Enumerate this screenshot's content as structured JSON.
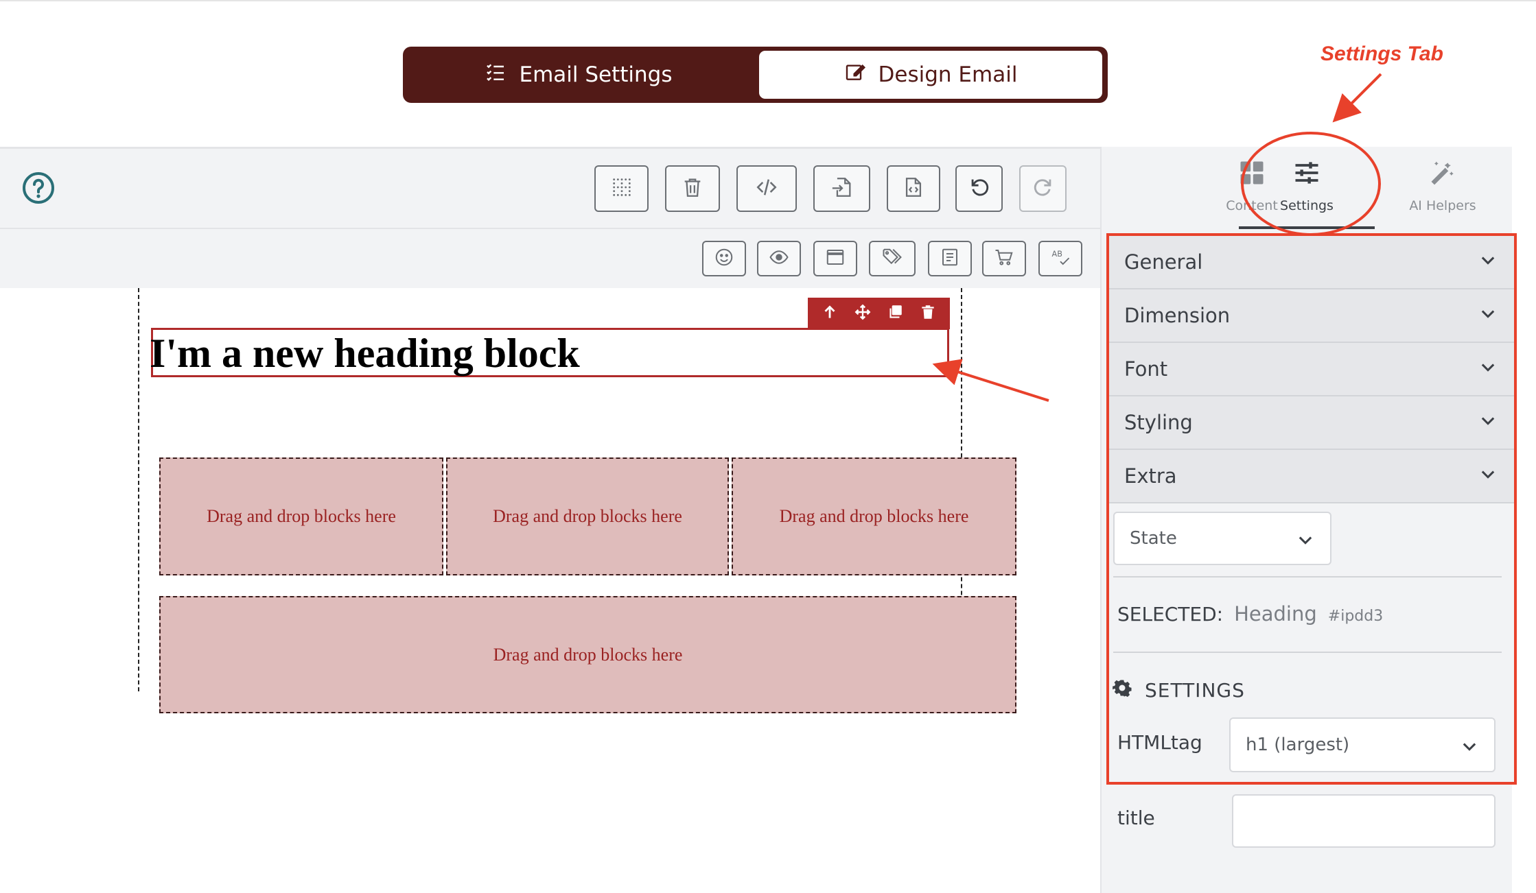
{
  "mode_toggle": {
    "email_settings_label": "Email Settings",
    "design_email_label": "Design Email"
  },
  "toolbar": {
    "top_buttons": [
      "sw-visibility-icon",
      "trash-icon",
      "code-icon",
      "import-icon",
      "export-icon",
      "undo-icon",
      "redo-icon"
    ],
    "bottom_buttons": [
      "emoji-icon",
      "eye-icon",
      "window-icon",
      "tags-icon",
      "form-icon",
      "cart-icon",
      "spellcheck-icon"
    ]
  },
  "canvas": {
    "heading_text": "I'm a new heading block",
    "drop_placeholder": "Drag and drop blocks here",
    "row1_cells": [
      "Drag and drop blocks here",
      "Drag and drop blocks here",
      "Drag and drop blocks here"
    ],
    "row2_cells": [
      "Drag and drop blocks here"
    ]
  },
  "annotation": {
    "label": "Settings Tab",
    "color": "#e8412b"
  },
  "panel": {
    "tabs": [
      {
        "label": "Content",
        "icon": "grid-icon"
      },
      {
        "label": "Settings",
        "icon": "sliders-icon"
      },
      {
        "label": "AI Helpers",
        "icon": "magic-wand-icon"
      }
    ],
    "active_tab": "Settings",
    "sectors": [
      "General",
      "Dimension",
      "Font",
      "Styling",
      "Extra"
    ],
    "state_placeholder": "State",
    "selected_label": "SELECTED:",
    "selected_name": "Heading",
    "selected_id": "#ipdd3",
    "settings_heading": "SETTINGS",
    "traits": [
      {
        "label": "HTMLtag",
        "value": "h1 (largest)"
      },
      {
        "label": "title",
        "value": ""
      }
    ]
  },
  "colors": {
    "brand_dark": "#521a17",
    "block_red": "#b02a2a",
    "drop_bg": "#dfbcbb",
    "panel_bg": "#f2f3f5"
  }
}
